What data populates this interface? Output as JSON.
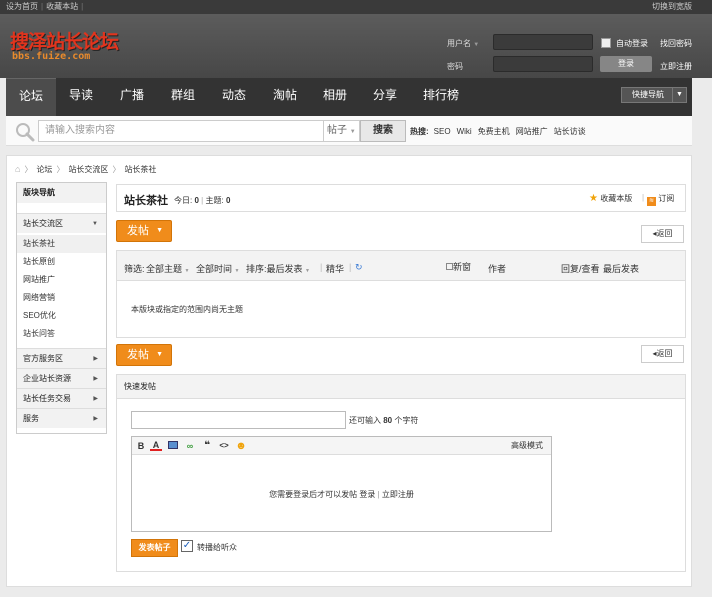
{
  "topbar": {
    "set_home": "设为首页",
    "bookmark": "收藏本站",
    "switch_style": "切换到宽版"
  },
  "logo": {
    "text": "搜泽站长论坛",
    "domain": "bbs.fuize.com"
  },
  "login": {
    "username_label": "用户名",
    "password_label": "密码",
    "auto_login": "自动登录",
    "recover_password": "找回密码",
    "login_button": "登录",
    "register": "立即注册"
  },
  "nav": {
    "items": [
      "论坛",
      "导读",
      "广播",
      "群组",
      "动态",
      "淘帖",
      "相册",
      "分享",
      "排行榜"
    ],
    "active": "论坛",
    "quick_nav": "快捷导航"
  },
  "search": {
    "placeholder": "请输入搜索内容",
    "type": "帖子",
    "button": "搜索",
    "hot_label": "热搜:",
    "hot": [
      "SEO",
      "Wiki",
      "免费主机",
      "网站推广",
      "站长访谈"
    ]
  },
  "breadcrumb": [
    "论坛",
    "站长交流区",
    "站长茶社"
  ],
  "sidebar": {
    "title": "版块导航",
    "group_open": "站长交流区",
    "items": [
      "站长茶社",
      "站长原创",
      "网站推广",
      "网络营销",
      "SEO优化",
      "站长问答"
    ],
    "current": "站长茶社",
    "groups": [
      "官方服务区",
      "企业站长资源",
      "站长任务交易",
      "服务"
    ]
  },
  "forum": {
    "title": "站长茶社",
    "today_label": "今日:",
    "today": "0",
    "threads_label": "主题:",
    "threads": "0",
    "favorite": "收藏本版",
    "subscribe": "订阅"
  },
  "actions": {
    "post": "发帖",
    "back": "返回"
  },
  "table": {
    "filter_label": "筛选:",
    "all_topics": "全部主题",
    "all_time": "全部时间",
    "sort_label": "排序:",
    "sort": "最后发表",
    "digest": "精华",
    "new_window": "新窗",
    "author": "作者",
    "reply_view": "回复/查看",
    "last_post": "最后发表",
    "empty": "本版块或指定的范围内尚无主题"
  },
  "quick_post": {
    "title": "快速发帖",
    "char_hint_prefix": "还可输入",
    "char_count": "80",
    "char_hint_suffix": "个字符",
    "advanced_mode": "高级模式",
    "login_msg": "您需要登录后才可以发帖",
    "login_link": "登录",
    "register_link": "立即注册",
    "submit": "发表帖子",
    "notify": "转播给听众"
  }
}
